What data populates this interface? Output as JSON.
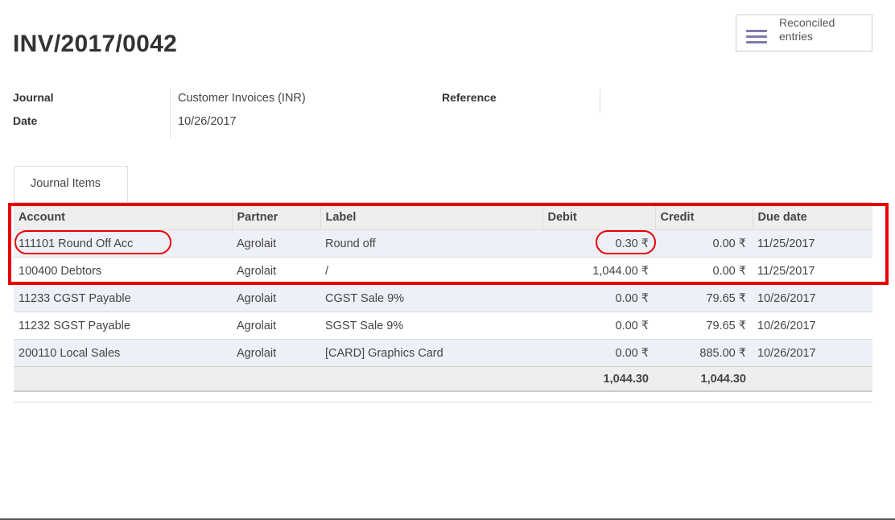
{
  "record": {
    "title": "INV/2017/0042"
  },
  "smart_button": {
    "label": "Reconciled entries"
  },
  "fields": {
    "journal_label": "Journal",
    "journal_value": "Customer Invoices (INR)",
    "date_label": "Date",
    "date_value": "10/26/2017",
    "reference_label": "Reference",
    "reference_value": ""
  },
  "tabs": [
    {
      "label": "Journal Items"
    }
  ],
  "table": {
    "columns": [
      "Account",
      "Partner",
      "Label",
      "Debit",
      "Credit",
      "Due date"
    ],
    "rows": [
      {
        "account": "111101 Round Off Acc",
        "partner": "Agrolait",
        "label": "Round off",
        "debit": "0.30 ₹",
        "credit": "0.00 ₹",
        "due_date": "11/25/2017"
      },
      {
        "account": "100400 Debtors",
        "partner": "Agrolait",
        "label": "/",
        "debit": "1,044.00 ₹",
        "credit": "0.00 ₹",
        "due_date": "11/25/2017"
      },
      {
        "account": "11233 CGST Payable",
        "partner": "Agrolait",
        "label": "CGST Sale 9%",
        "debit": "0.00 ₹",
        "credit": "79.65 ₹",
        "due_date": "10/26/2017"
      },
      {
        "account": "11232 SGST Payable",
        "partner": "Agrolait",
        "label": "SGST Sale 9%",
        "debit": "0.00 ₹",
        "credit": "79.65 ₹",
        "due_date": "10/26/2017"
      },
      {
        "account": "200110 Local Sales",
        "partner": "Agrolait",
        "label": "[CARD] Graphics Card",
        "debit": "0.00 ₹",
        "credit": "885.00 ₹",
        "due_date": "10/26/2017"
      }
    ],
    "totals": {
      "debit": "1,044.30",
      "credit": "1,044.30"
    }
  },
  "annotations": {
    "color": "#e60000"
  },
  "icons": {
    "smart_button_icon": "bars-icon"
  }
}
